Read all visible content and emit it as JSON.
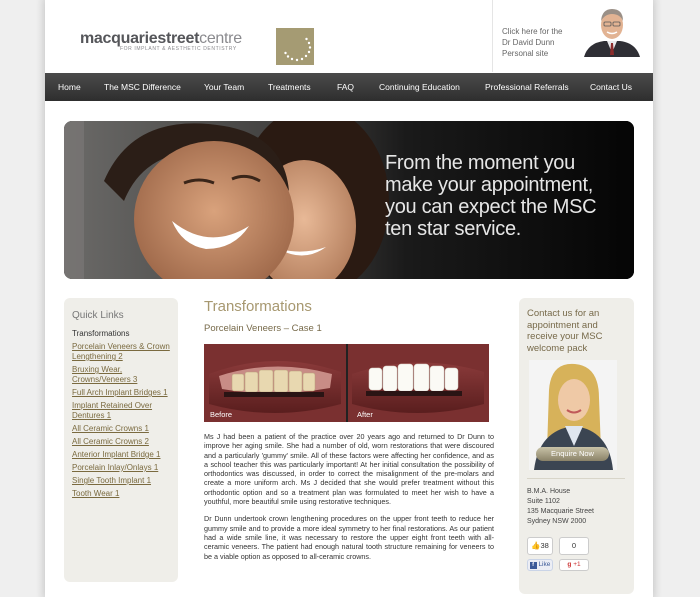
{
  "header": {
    "logo_main_bold": "macquarie",
    "logo_main_bold2": "street",
    "logo_main_light": "centre",
    "logo_sub": "FOR IMPLANT & AESTHETIC DENTISTRY",
    "promo_line1": "Click here for the",
    "promo_line2": "Dr David Dunn",
    "promo_line3": "Personal site"
  },
  "nav": {
    "items": [
      "Home",
      "The MSC Difference",
      "Your Team",
      "Treatments",
      "FAQ",
      "Continuing Education",
      "Professional Referrals",
      "Contact Us"
    ]
  },
  "hero": {
    "line1": "From the moment you",
    "line2": "make your appointment,",
    "line3": "you can expect the MSC",
    "line4": "ten star service."
  },
  "quicklinks": {
    "title": "Quick Links",
    "active": "Transformations",
    "links": [
      "Porcelain Veneers & Crown Lengthening 2",
      "Bruxing Wear, Crowns/Veneers 3",
      "Full Arch Implant Bridges 1",
      "Implant Retained Over Dentures 1",
      "All Ceramic Crowns 1",
      "All Ceramic Crowns 2",
      "Anterior Implant Bridge 1",
      "Porcelain Inlay/Onlays 1",
      "Single Tooth Implant 1",
      "Tooth Wear 1"
    ]
  },
  "main": {
    "title": "Transformations",
    "subtitle": "Porcelain Veneers – Case 1",
    "before_label": "Before",
    "after_label": "After",
    "para1": "Ms J had been a patient of the practice over 20 years ago and returned to Dr Dunn to improve her aging smile. She had a number of old, worn restorations that were discoured and a particularly 'gummy' smile. All of these factors were affecting her confidence, and as a school teacher this was particularly important! At her initial consultation the possibility of orthodontics was discussed, in order to correct the misalignment of the pre-molars and create a more uniform arch. Ms J decided that she would prefer treatment without this orthodontic option and so a treatment plan was formulated to meet her wish to have a youthful, more beautiful smile using restorative techniques.",
    "para2": "Dr Dunn undertook crown lengthening procedures on the upper front teeth to reduce her gummy smile and to provide a more ideal symmetry to her final restorations. As our patient had a wide smile line, it was necessary to restore the upper eight front teeth with all-ceramic veneers. The patient had enough natural tooth structure remaining for veneers to be a viable option as opposed to all-ceramic crowns."
  },
  "contact": {
    "title": "Contact us for an appointment and receive your MSC welcome pack",
    "enquire": "Enquire Now",
    "address": [
      "B.M.A. House",
      "Suite 1102",
      "135 Macquarie Street",
      "Sydney NSW 2000"
    ],
    "fb_count": "38",
    "fb_like": "Like",
    "g_count": "0",
    "g_plus": "+1"
  },
  "colors": {
    "accent": "#a79870",
    "nav_bg": "#3a3a3a",
    "panel_bg": "#efeee9",
    "link": "#7a6a3f"
  }
}
